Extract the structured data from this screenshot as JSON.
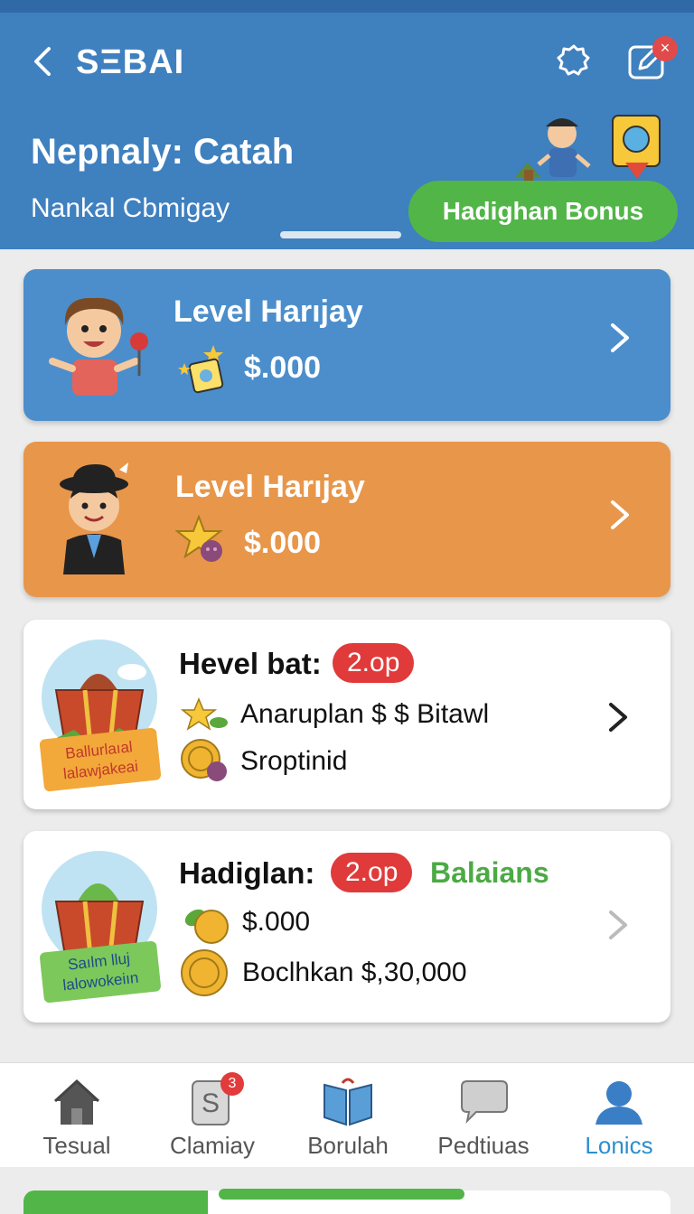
{
  "header": {
    "app_title": "SΞBAI",
    "title": "Nepnaly: Catah",
    "subtitle": "Nankal Cbmigay",
    "bonus_button": "Hadighan Bonus",
    "notification_badge": "×",
    "color": "#3f80bf"
  },
  "cards": [
    {
      "title": "Level Harıjay",
      "amount": "$.000",
      "color": "#4b8ecb"
    },
    {
      "title": "Level Harıjay",
      "amount": "$.000",
      "color": "#e8964a"
    }
  ],
  "reward_cards": [
    {
      "title": "Hevel bat:",
      "pill": "2.op",
      "extra": "",
      "lines": [
        "Anaruplan $ $ Bitawl",
        "Sroptinid"
      ],
      "gift_label": [
        "Ballurlaıal",
        "lalawjakeai"
      ]
    },
    {
      "title": "Hadiglan:",
      "pill": "2.op",
      "extra": "Balaians",
      "lines": [
        "$.000",
        "Boclhkan $,30,000"
      ],
      "gift_label": [
        "Saılm lluj",
        "lalowokeiın"
      ]
    }
  ],
  "tabs": [
    {
      "label": "Tesual",
      "icon": "home-icon"
    },
    {
      "label": "Clamiay",
      "icon": "receipt-icon",
      "badge": "3"
    },
    {
      "label": "Borulah",
      "icon": "book-icon"
    },
    {
      "label": "Pedtiuas",
      "icon": "chat-icon"
    },
    {
      "label": "Lonics",
      "icon": "profile-icon",
      "active": true
    }
  ],
  "colors": {
    "accent": "#52b548",
    "pill": "#e03a3a",
    "active_tab": "#2a8fd0"
  }
}
